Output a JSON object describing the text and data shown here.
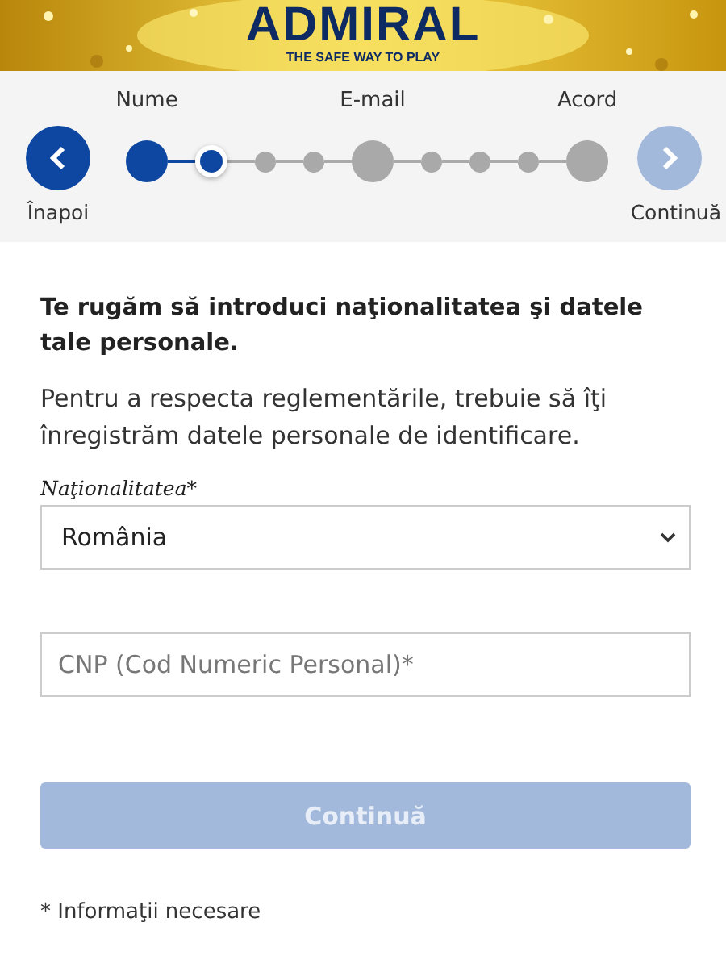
{
  "header": {
    "logo": "ADMIRAL",
    "tagline": "THE SAFE WAY TO PLAY"
  },
  "stepper": {
    "back": {
      "label": "Înapoi",
      "disabled": false
    },
    "next": {
      "label": "Continuă",
      "disabled": true
    },
    "steps": [
      {
        "label": "Nume",
        "kind": "major",
        "done": true,
        "selected": false
      },
      {
        "kind": "minor",
        "done": false,
        "selected": true
      },
      {
        "kind": "minor",
        "done": false,
        "selected": false
      },
      {
        "kind": "minor",
        "done": false,
        "selected": false
      },
      {
        "label": "E-mail",
        "kind": "major",
        "done": false,
        "selected": false
      },
      {
        "kind": "minor",
        "done": false,
        "selected": false
      },
      {
        "kind": "minor",
        "done": false,
        "selected": false
      },
      {
        "kind": "minor",
        "done": false,
        "selected": false
      },
      {
        "label": "Acord",
        "kind": "major",
        "done": false,
        "selected": false
      }
    ]
  },
  "form": {
    "heading": "Te rugăm să introduci naţionalitatea şi datele tale personale.",
    "intro": "Pentru a respecta reglementările, trebuie să îţi înregistrăm datele personale de identificare.",
    "nationality": {
      "label": "Naţionalitatea*",
      "value": "România"
    },
    "cnp": {
      "placeholder": "CNP (Cod Numeric Personal)*"
    },
    "submit": {
      "label": "Continuă",
      "disabled": true
    },
    "footnote": "* Informaţii necesare"
  }
}
